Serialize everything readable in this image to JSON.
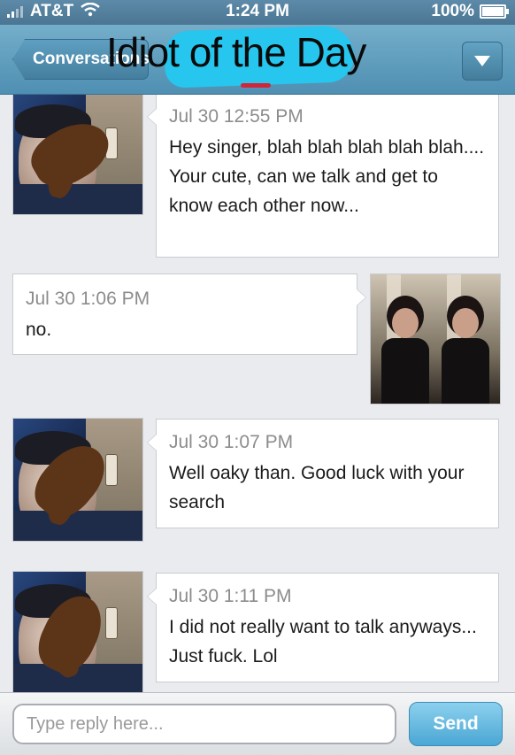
{
  "status_bar": {
    "carrier": "AT&T",
    "time": "1:24 PM",
    "battery": "100%",
    "signal_icon": "signal-bars-icon",
    "wifi_icon": "wifi-icon",
    "battery_icon": "battery-icon"
  },
  "nav": {
    "back_label": "Conversations",
    "title": "Idiot of the Day",
    "menu_icon": "chevron-down-icon"
  },
  "messages": [
    {
      "side": "left",
      "timestamp": "Jul 30 12:55 PM",
      "text": "Hey singer, blah blah blah blah blah.... Your cute, can we talk and get to know each other now..."
    },
    {
      "side": "right",
      "timestamp": "Jul 30 1:06 PM",
      "text": "no."
    },
    {
      "side": "left",
      "timestamp": "Jul 30 1:07 PM",
      "text": "Well oaky than. Good luck with your search"
    },
    {
      "side": "left",
      "timestamp": "Jul 30 1:11 PM",
      "text": "I did not really want to talk anyways... Just fuck. Lol"
    }
  ],
  "composer": {
    "placeholder": "Type reply here...",
    "send_label": "Send"
  },
  "colors": {
    "nav_blue": "#5f9fc1",
    "title_highlight": "#27c6ee",
    "send_blue": "#4aa7d4",
    "scribble_brown": "#5c3418"
  }
}
